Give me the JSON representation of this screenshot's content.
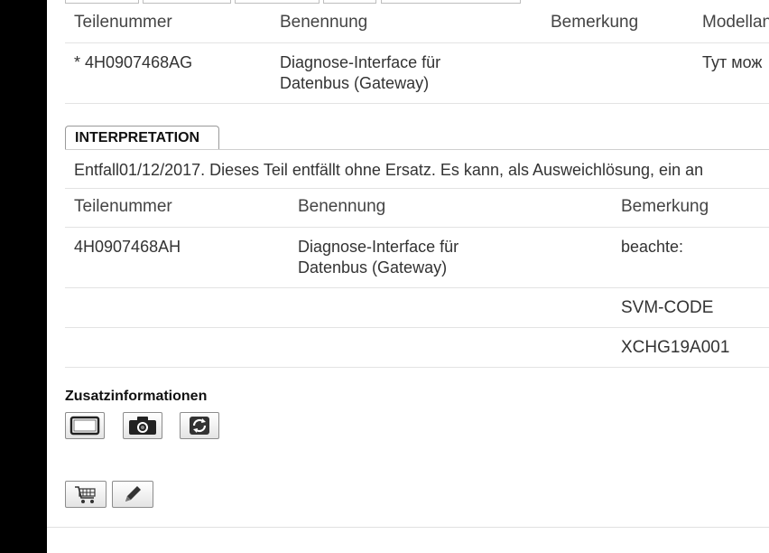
{
  "table1": {
    "headers": [
      "Teilenummer",
      "Benennung",
      "Bemerkung",
      "Modellan"
    ],
    "row": {
      "part_number": "* 4H0907468AG",
      "name_line1": "Diagnose-Interface für",
      "name_line2": "Datenbus (Gateway)",
      "remark": "",
      "model": "Тут мож"
    }
  },
  "interpretation": {
    "tab_label": "INTERPRETATION",
    "text": "Entfall01/12/2017. Dieses Teil entfällt ohne Ersatz. Es kann, als Ausweichlösung, ein an"
  },
  "table2": {
    "headers": [
      "Teilenummer",
      "Benennung",
      "Bemerkung"
    ],
    "rows": [
      {
        "part_number": "4H0907468AH",
        "name_line1": "Diagnose-Interface für",
        "name_line2": "Datenbus (Gateway)",
        "remark": "beachte:"
      },
      {
        "part_number": "",
        "name_line1": "",
        "name_line2": "",
        "remark": "SVM-CODE"
      },
      {
        "part_number": "",
        "name_line1": "",
        "name_line2": "",
        "remark": "XCHG19A001"
      }
    ]
  },
  "additional_info": {
    "title": "Zusatzinformationen",
    "icons": [
      "frame-icon",
      "camera-icon",
      "refresh-icon"
    ]
  },
  "actions": {
    "icons": [
      "cart-icon",
      "pencil-icon"
    ]
  }
}
